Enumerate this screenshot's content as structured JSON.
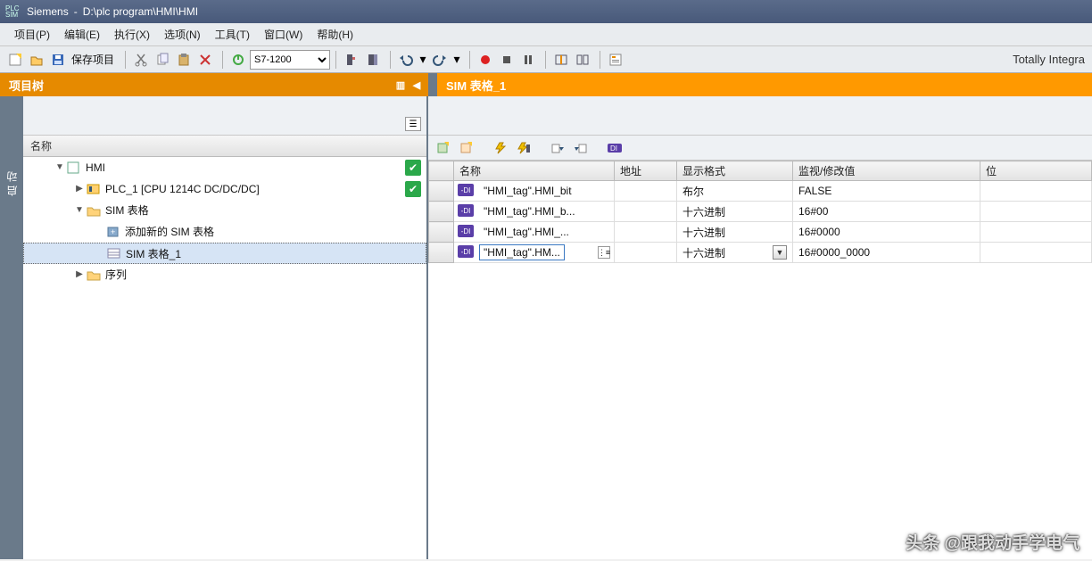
{
  "title_bar": {
    "app": "Siemens",
    "sep": "-",
    "path": "D:\\plc program\\HMI\\HMI",
    "icon_top": "PLC",
    "icon_bot": "SIM"
  },
  "menu": {
    "project": "项目(P)",
    "edit": "编辑(E)",
    "execute": "执行(X)",
    "options": "选项(N)",
    "tools": "工具(T)",
    "window": "窗口(W)",
    "help": "帮助(H)"
  },
  "toolbar": {
    "save_label": "保存项目",
    "cpu_select": "S7-1200",
    "brand": "Totally Integra"
  },
  "panels": {
    "project_tree_title": "项目树",
    "sim_table_title": "SIM 表格_1",
    "left_rail": "启动"
  },
  "tree": {
    "header": "名称",
    "root": "HMI",
    "plc": "PLC_1 [CPU 1214C DC/DC/DC]",
    "sim_group": "SIM 表格",
    "add_new": "添加新的 SIM 表格",
    "sim1": "SIM 表格_1",
    "sequence": "序列"
  },
  "table": {
    "columns": {
      "name": "名称",
      "address": "地址",
      "format": "显示格式",
      "monitor": "监视/修改值",
      "bit": "位"
    },
    "rows": [
      {
        "name": "\"HMI_tag\".HMI_bit",
        "address": "",
        "format": "布尔",
        "value": "FALSE",
        "editing": false
      },
      {
        "name": "\"HMI_tag\".HMI_b...",
        "address": "",
        "format": "十六进制",
        "value": "16#00",
        "editing": false
      },
      {
        "name": "\"HMI_tag\".HMI_...",
        "address": "",
        "format": "十六进制",
        "value": "16#0000",
        "editing": false
      },
      {
        "name": "\"HMI_tag\".HM...",
        "address": "",
        "format": "十六进制",
        "value": "16#0000_0000",
        "editing": true
      }
    ]
  },
  "watermark": "头条 @跟我动手学电气"
}
